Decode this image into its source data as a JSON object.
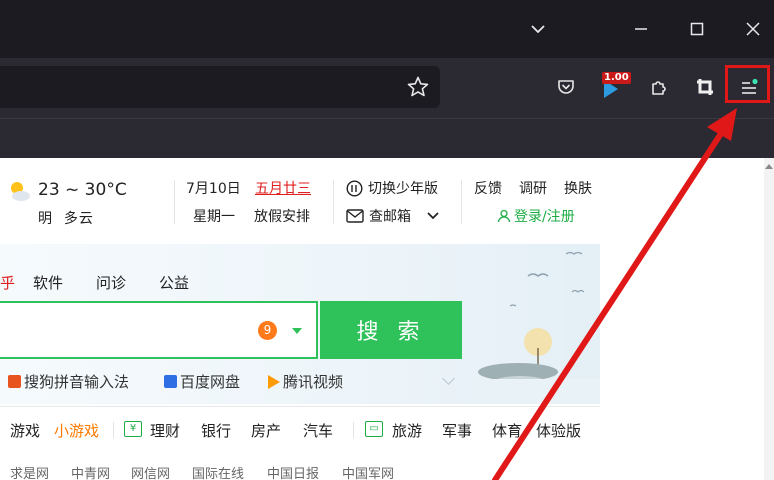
{
  "browser": {
    "toolbar_badge": "1.00"
  },
  "weather": {
    "temperature": "23 ~ 30°C",
    "day_label": "明",
    "condition": "多云",
    "icon": "partly-cloudy-icon"
  },
  "date_info": {
    "date": "7月10日",
    "lunar": "五月廿三",
    "weekday": "星期一",
    "holiday": "放假安排"
  },
  "tools": {
    "youth_mode": "切换少年版",
    "mail": "查邮箱",
    "feedback": "反馈",
    "survey": "调研",
    "skin": "换肤",
    "login": "登录/注册"
  },
  "search": {
    "tabs": [
      "乎",
      "软件",
      "问诊",
      "公益"
    ],
    "badge_count": "9",
    "button_label": "搜 索",
    "quick_links": [
      "搜狗拼音输入法",
      "百度网盘",
      "腾讯视频"
    ]
  },
  "categories": [
    "游戏",
    "小游戏",
    "理财",
    "银行",
    "房产",
    "汽车",
    "旅游",
    "军事",
    "体育",
    "体验版"
  ],
  "news_links": [
    "求是网",
    "中青网",
    "网信网",
    "国际在线",
    "中国日报",
    "中国军网"
  ],
  "colors": {
    "accent_green": "#2fc15a",
    "annotation_red": "#e01818",
    "badge_orange": "#ff7a1a"
  }
}
